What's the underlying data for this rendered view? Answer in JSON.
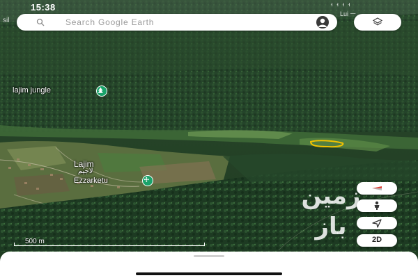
{
  "status_bar": {
    "time": "15:38",
    "right_top": "ᅥᅥᅥᅥ",
    "right_bottom": "Lui ᅳ"
  },
  "edge_label": "sil",
  "search": {
    "placeholder": "Search Google Earth"
  },
  "places": [
    {
      "name": "lajim jungle",
      "icon": "park-icon"
    },
    {
      "name": "Lajim",
      "subname": "لاجیم"
    },
    {
      "name": "Ezzarketu",
      "icon": "poi-icon"
    }
  ],
  "watermark": {
    "text": "زمین باز"
  },
  "controls": {
    "compass": "compass-icon",
    "street_view": "pegman-icon",
    "my_location": "location-arrow-icon",
    "view_mode": "2D"
  },
  "scale": {
    "label": "500 m"
  },
  "colors": {
    "forest_dark": "#1e3b1f",
    "forest_mid": "#2f5a2c",
    "field": "#4d7a3e",
    "highlight": "#f2c200",
    "poi_green": "#1aa36a",
    "compass_red": "#e0433a"
  }
}
